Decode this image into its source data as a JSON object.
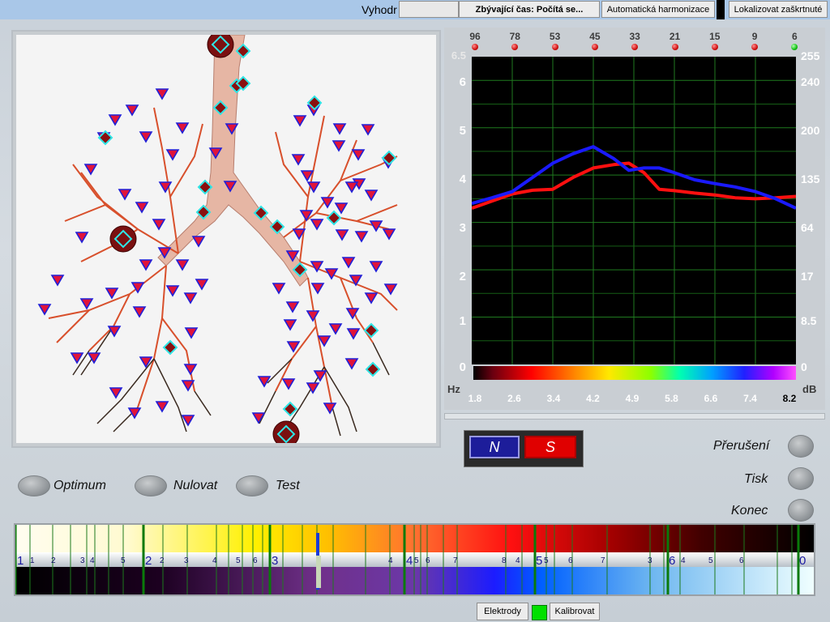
{
  "top": {
    "prefix": "Vyhodr",
    "remaining": "Zbývající čas: Počítá se...",
    "auto_harm": "Automatická harmonizace",
    "localize": "Lokalizovat zaškrtnuté"
  },
  "graph": {
    "top_numbers": [
      "96",
      "78",
      "53",
      "45",
      "33",
      "21",
      "15",
      "9",
      "6"
    ],
    "left_axis": [
      "6.5",
      "6",
      "5",
      "4",
      "3",
      "2",
      "1",
      "0"
    ],
    "right_axis": [
      "255",
      "240",
      "200",
      "135",
      "64",
      "17",
      "8.5",
      "0"
    ],
    "hz_label": "Hz",
    "db_label": "dB",
    "hz_ticks": [
      "1.8",
      "2.6",
      "3.4",
      "4.2",
      "4.9",
      "5.8",
      "6.6",
      "7.4",
      "8.2"
    ]
  },
  "chart_data": {
    "type": "line",
    "x": [
      1.8,
      2.2,
      2.6,
      3.0,
      3.4,
      3.8,
      4.2,
      4.6,
      4.9,
      5.2,
      5.5,
      5.8,
      6.2,
      6.6,
      7.0,
      7.4,
      7.8,
      8.2
    ],
    "series": [
      {
        "color": "#ff1010",
        "values": [
          3.3,
          3.45,
          3.6,
          3.68,
          3.7,
          3.95,
          4.15,
          4.22,
          4.25,
          4.05,
          3.7,
          3.67,
          3.62,
          3.58,
          3.52,
          3.5,
          3.52,
          3.55
        ]
      },
      {
        "color": "#1a1aff",
        "values": [
          3.4,
          3.52,
          3.65,
          3.95,
          4.25,
          4.45,
          4.6,
          4.35,
          4.1,
          4.15,
          4.15,
          4.05,
          3.9,
          3.82,
          3.75,
          3.65,
          3.5,
          3.3
        ]
      }
    ],
    "ylim": [
      0,
      6.5
    ],
    "xlim": [
      1.8,
      8.2
    ]
  },
  "ns": {
    "n": "N",
    "s": "S"
  },
  "controls": {
    "optimum": "Optimum",
    "nulovat": "Nulovat",
    "test": "Test",
    "preruseni": "Přerušení",
    "tisk": "Tisk",
    "konec": "Konec"
  },
  "scale": {
    "big_numbers": [
      "1",
      "2",
      "3",
      "4",
      "5",
      "6",
      "0"
    ],
    "small_numbers": [
      "1",
      "2",
      "3",
      "4",
      "5",
      "2",
      "3",
      "4",
      "5",
      "6",
      "4",
      "5",
      "6",
      "7",
      "8",
      "4",
      "5",
      "6",
      "7",
      "3",
      "4",
      "5",
      "6"
    ]
  },
  "bottom": {
    "electrodes": "Elektrody",
    "calibrate": "Kalibrovat"
  }
}
